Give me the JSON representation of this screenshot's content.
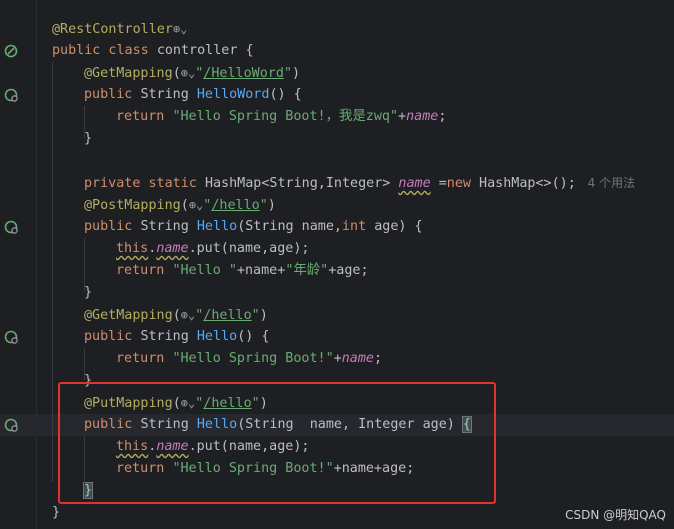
{
  "editor": {
    "lines": [
      {
        "tokens": [
          [
            "ann",
            "@RestController"
          ],
          [
            "globe",
            "⊕⌄"
          ]
        ],
        "indent": 0
      },
      {
        "tokens": [
          [
            "kw",
            "public class "
          ],
          [
            "plain",
            "controller {"
          ]
        ],
        "indent": 0,
        "icon": "bean-icon"
      },
      {
        "tokens": [
          [
            "ann",
            "@GetMapping"
          ],
          [
            "plain",
            "("
          ],
          [
            "globe",
            "⊕⌄"
          ],
          [
            "str",
            "\""
          ],
          [
            "url",
            "/HelloWord"
          ],
          [
            "str",
            "\""
          ],
          [
            "plain",
            ")"
          ]
        ],
        "indent": 1
      },
      {
        "tokens": [
          [
            "kw",
            "public "
          ],
          [
            "plain",
            "String "
          ],
          [
            "fn",
            "HelloWord"
          ],
          [
            "plain",
            "() {"
          ]
        ],
        "indent": 1,
        "icon": "endpoint-icon"
      },
      {
        "tokens": [
          [
            "kw",
            "return "
          ],
          [
            "str",
            "\"Hello Spring Boot!，我是zwq\""
          ],
          [
            "plain",
            "+"
          ],
          [
            "fld",
            "name"
          ],
          [
            "plain",
            ";"
          ]
        ],
        "indent": 2
      },
      {
        "tokens": [
          [
            "plain",
            "}"
          ]
        ],
        "indent": 1
      },
      {
        "tokens": [],
        "indent": 0
      },
      {
        "tokens": [
          [
            "kw",
            "private static "
          ],
          [
            "plain",
            "HashMap<String,Integer> "
          ],
          [
            "fldu",
            "name"
          ],
          [
            "plain",
            " ="
          ],
          [
            "kw",
            "new "
          ],
          [
            "plain",
            "HashMap<>(); "
          ],
          [
            "hint",
            " 4 个用法"
          ]
        ],
        "indent": 1
      },
      {
        "tokens": [
          [
            "ann",
            "@PostMapping"
          ],
          [
            "plain",
            "("
          ],
          [
            "globe",
            "⊕⌄"
          ],
          [
            "str",
            "\""
          ],
          [
            "url",
            "/hello"
          ],
          [
            "str",
            "\""
          ],
          [
            "plain",
            ")"
          ]
        ],
        "indent": 1
      },
      {
        "tokens": [
          [
            "kw",
            "public "
          ],
          [
            "plain",
            "String "
          ],
          [
            "fn",
            "Hello"
          ],
          [
            "plain",
            "(String name,"
          ],
          [
            "kw",
            "int "
          ],
          [
            "plain",
            "age) {"
          ]
        ],
        "indent": 1,
        "icon": "endpoint-icon"
      },
      {
        "tokens": [
          [
            "thisu",
            "this"
          ],
          [
            "plain",
            "."
          ],
          [
            "fldu",
            "name"
          ],
          [
            "plain",
            ".put(name,age);"
          ]
        ],
        "indent": 2
      },
      {
        "tokens": [
          [
            "kw",
            "return "
          ],
          [
            "str",
            "\"Hello \""
          ],
          [
            "plain",
            "+name+"
          ],
          [
            "str",
            "\"年龄\""
          ],
          [
            "plain",
            "+age;"
          ]
        ],
        "indent": 2
      },
      {
        "tokens": [
          [
            "plain",
            "}"
          ]
        ],
        "indent": 1
      },
      {
        "tokens": [
          [
            "ann",
            "@GetMapping"
          ],
          [
            "plain",
            "("
          ],
          [
            "globe",
            "⊕⌄"
          ],
          [
            "str",
            "\""
          ],
          [
            "url",
            "/hello"
          ],
          [
            "str",
            "\""
          ],
          [
            "plain",
            ")"
          ]
        ],
        "indent": 1
      },
      {
        "tokens": [
          [
            "kw",
            "public "
          ],
          [
            "plain",
            "String "
          ],
          [
            "fn",
            "Hello"
          ],
          [
            "plain",
            "() {"
          ]
        ],
        "indent": 1,
        "icon": "endpoint-icon"
      },
      {
        "tokens": [
          [
            "kw",
            "return "
          ],
          [
            "str",
            "\"Hello Spring Boot!\""
          ],
          [
            "plain",
            "+"
          ],
          [
            "fld",
            "name"
          ],
          [
            "plain",
            ";"
          ]
        ],
        "indent": 2
      },
      {
        "tokens": [
          [
            "plain",
            "}"
          ]
        ],
        "indent": 1
      },
      {
        "tokens": [
          [
            "ann",
            "@PutMapping"
          ],
          [
            "plain",
            "("
          ],
          [
            "globe",
            "⊕⌄"
          ],
          [
            "str",
            "\""
          ],
          [
            "url",
            "/hello"
          ],
          [
            "str",
            "\""
          ],
          [
            "plain",
            ")"
          ]
        ],
        "indent": 1
      },
      {
        "tokens": [
          [
            "kw",
            "public "
          ],
          [
            "plain",
            "String "
          ],
          [
            "fn",
            "Hello"
          ],
          [
            "plain",
            "(String  name, Integer age) "
          ],
          [
            "bracehl",
            "{"
          ]
        ],
        "indent": 1,
        "icon": "endpoint-icon",
        "current": true
      },
      {
        "tokens": [
          [
            "thisu",
            "this"
          ],
          [
            "plain",
            "."
          ],
          [
            "fldu",
            "name"
          ],
          [
            "plain",
            ".put(name,age);"
          ]
        ],
        "indent": 2
      },
      {
        "tokens": [
          [
            "kw",
            "return "
          ],
          [
            "str",
            "\"Hello Spring Boot!\""
          ],
          [
            "plain",
            "+name+age;"
          ]
        ],
        "indent": 2
      },
      {
        "tokens": [
          [
            "bracehl",
            "}"
          ]
        ],
        "indent": 1
      },
      {
        "tokens": [
          [
            "plain",
            "}"
          ]
        ],
        "indent": 0
      }
    ]
  },
  "watermark": "CSDN @明知QAQ",
  "colors": {
    "background": "#1e1f22",
    "highlight_box": "#e3312c",
    "annotation": "#b3ae60",
    "keyword": "#cf8e6d",
    "string": "#6aab73",
    "method": "#56a8f5",
    "field": "#c77dbb"
  }
}
